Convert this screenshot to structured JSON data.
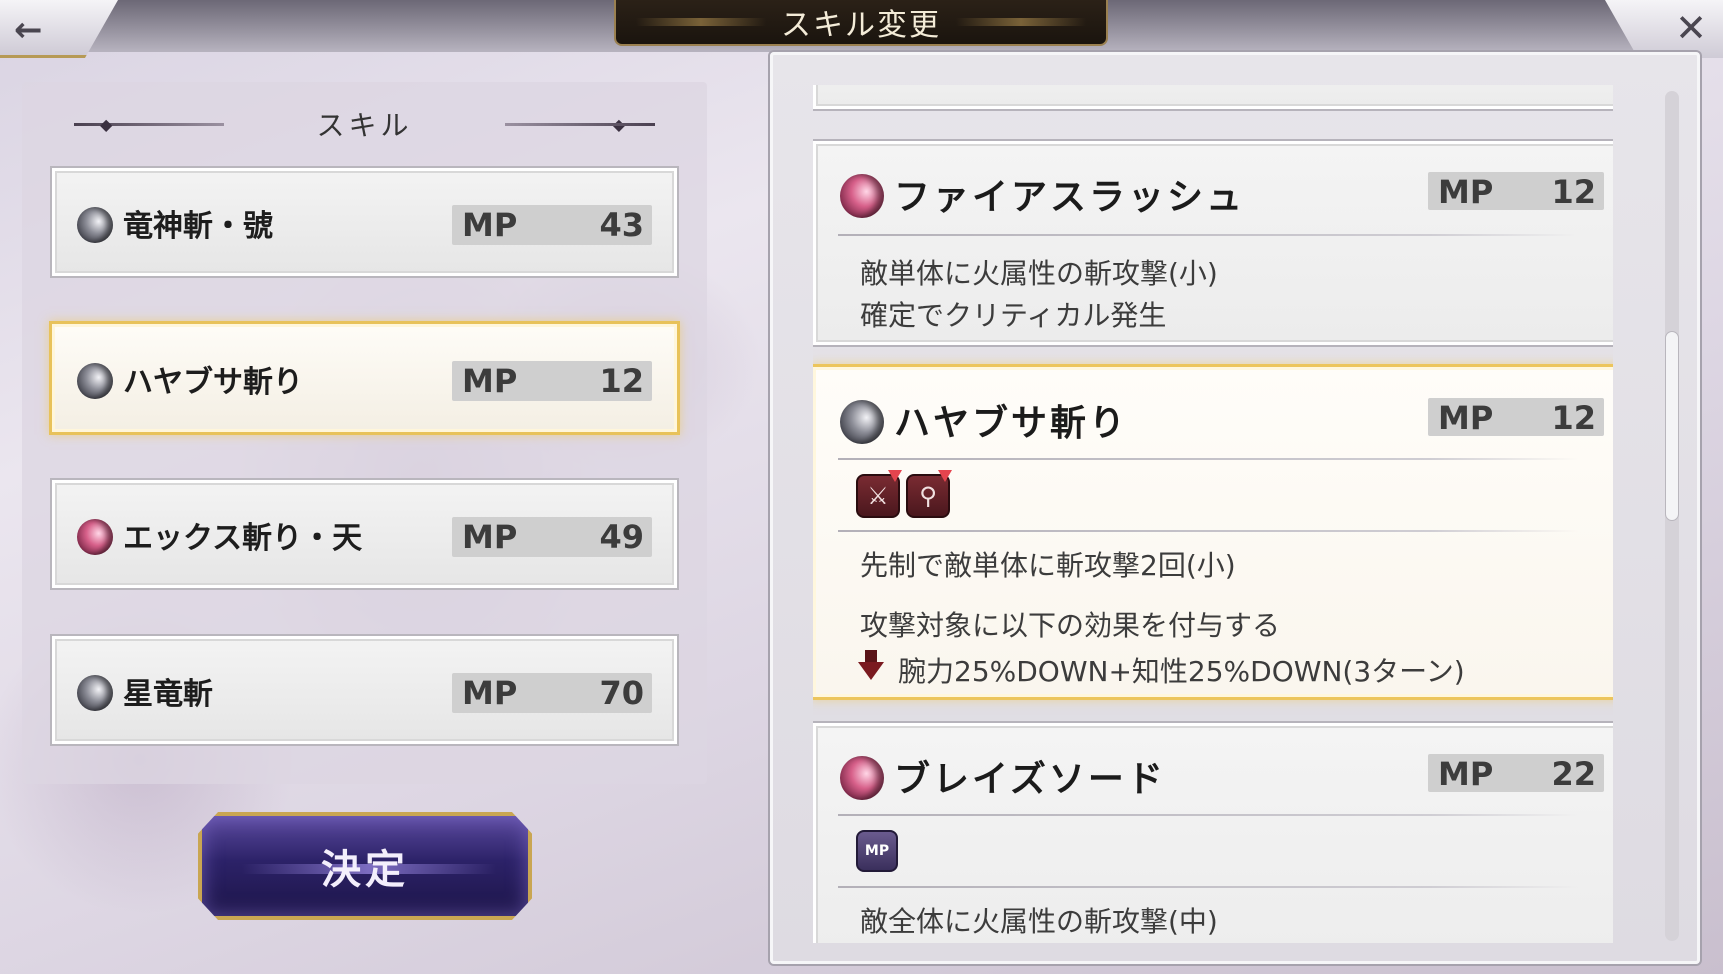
{
  "header": {
    "title": "スキル変更",
    "back_icon": "←",
    "close_icon": "✕"
  },
  "left": {
    "section_title": "スキル",
    "skills": [
      {
        "name": "竜神斬・號",
        "mp_label": "MP",
        "mp": "43",
        "element": "dark"
      },
      {
        "name": "ハヤブサ斬り",
        "mp_label": "MP",
        "mp": "12",
        "element": "dark",
        "selected": true
      },
      {
        "name": "エックス斬り・天",
        "mp_label": "MP",
        "mp": "49",
        "element": "fire"
      },
      {
        "name": "星竜斬",
        "mp_label": "MP",
        "mp": "70",
        "element": "dark"
      }
    ],
    "decide_label": "決定"
  },
  "right": {
    "cards": [
      {
        "name": "ファイアスラッシュ",
        "mp_label": "MP",
        "mp": "12",
        "element": "fire",
        "desc": [
          "敵単体に火属性の斬攻撃(小)",
          "確定でクリティカル発生"
        ]
      },
      {
        "name": "ハヤブサ斬り",
        "mp_label": "MP",
        "mp": "12",
        "element": "dark",
        "selected": true,
        "icons": [
          "sword-debuff-icon",
          "magic-debuff-icon"
        ],
        "desc": [
          "先制で敵単体に斬攻撃2回(小)",
          "攻撃対象に以下の効果を付与する",
          "腕力25%DOWN+知性25%DOWN(3ターン)"
        ]
      },
      {
        "name": "ブレイズソード",
        "mp_label": "MP",
        "mp": "22",
        "element": "fire",
        "icons": [
          "mp-icon"
        ],
        "icon_text": "MP",
        "desc": [
          "敵全体に火属性の斬攻撃(中)"
        ]
      }
    ]
  },
  "colors": {
    "selected_glow": "#ecc55c",
    "fire_orb": "#d7608a",
    "dark_orb": "#3a3b44",
    "decide_bg": "#2c2268"
  }
}
